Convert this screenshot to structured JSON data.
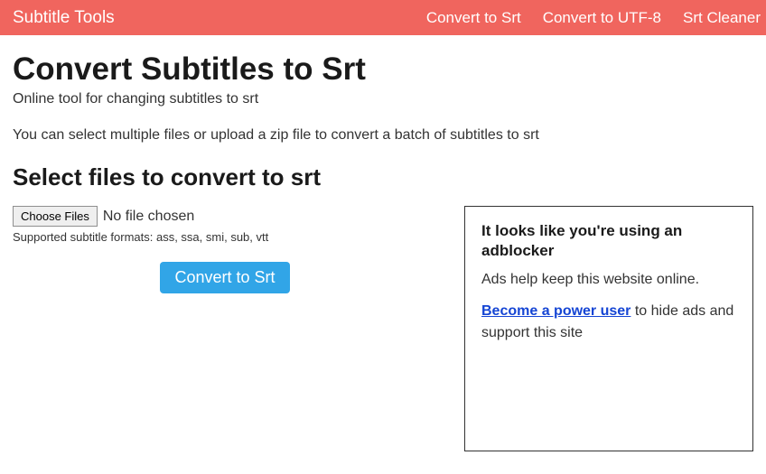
{
  "nav": {
    "brand": "Subtitle Tools",
    "links": [
      "Convert to Srt",
      "Convert to UTF-8",
      "Srt Cleaner"
    ]
  },
  "page": {
    "title": "Convert Subtitles to Srt",
    "subtitle": "Online tool for changing subtitles to srt",
    "instructions": "You can select multiple files or upload a zip file to convert a batch of subtitles to srt",
    "section_title": "Select files to convert to srt"
  },
  "upload": {
    "choose_label": "Choose Files",
    "file_status": "No file chosen",
    "supported": "Supported subtitle formats: ass, ssa, smi, sub, vtt",
    "convert_label": "Convert to Srt"
  },
  "adbox": {
    "title": "It looks like you're using an adblocker",
    "text": "Ads help keep this website online.",
    "link_text": "Become a power user",
    "suffix": " to hide ads and support this site"
  }
}
